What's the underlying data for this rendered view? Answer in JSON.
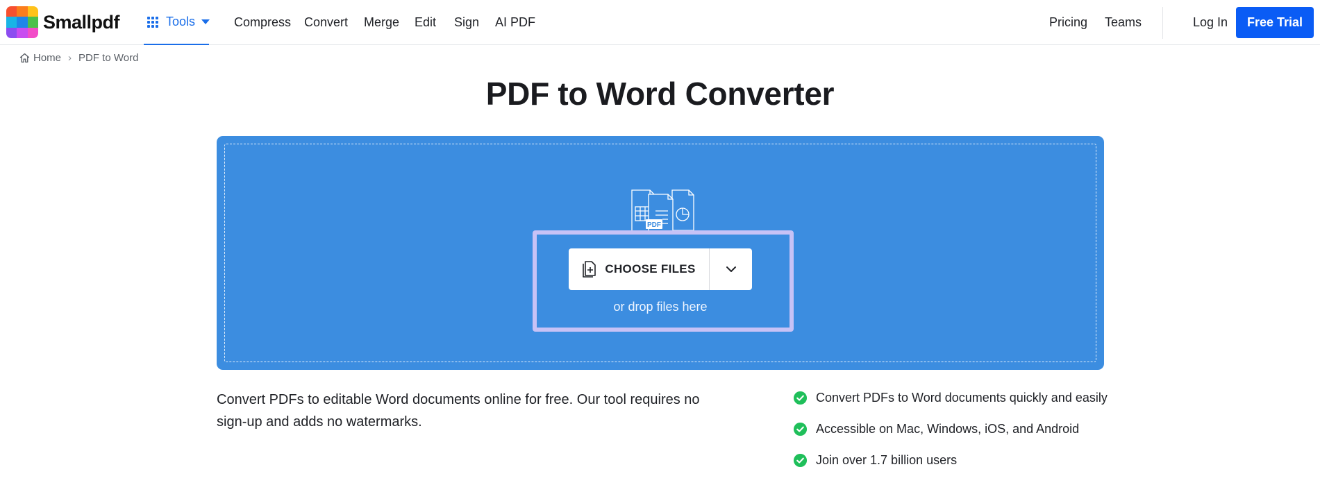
{
  "header": {
    "brand": "Smallpdf",
    "tools_label": "Tools",
    "nav": [
      "Compress",
      "Convert",
      "Merge",
      "Edit",
      "Sign",
      "AI PDF"
    ],
    "pricing": "Pricing",
    "teams": "Teams",
    "login": "Log In",
    "free_trial": "Free Trial"
  },
  "breadcrumb": {
    "home": "Home",
    "current": "PDF to Word"
  },
  "title": "PDF to Word Converter",
  "dropzone": {
    "illustration_badge": "PDF",
    "choose_label": "CHOOSE FILES",
    "drop_hint": "or drop files here"
  },
  "description": "Convert PDFs to editable Word documents online for free. Our tool requires no sign-up and adds no watermarks.",
  "features": [
    "Convert PDFs to Word documents quickly and easily",
    "Accessible on Mac, Windows, iOS, and Android",
    "Join over 1.7 billion users"
  ],
  "colors": {
    "accent": "#1a6ee9",
    "cta": "#0a5cf5",
    "dropzone": "#3c8de0",
    "focus_ring": "#c7c2f6",
    "check": "#1fbf5a"
  },
  "icons": [
    "logo-mark",
    "grid-icon",
    "caret-down-icon",
    "home-icon",
    "file-plus-icon",
    "chevron-down-icon",
    "check-circle-icon"
  ]
}
